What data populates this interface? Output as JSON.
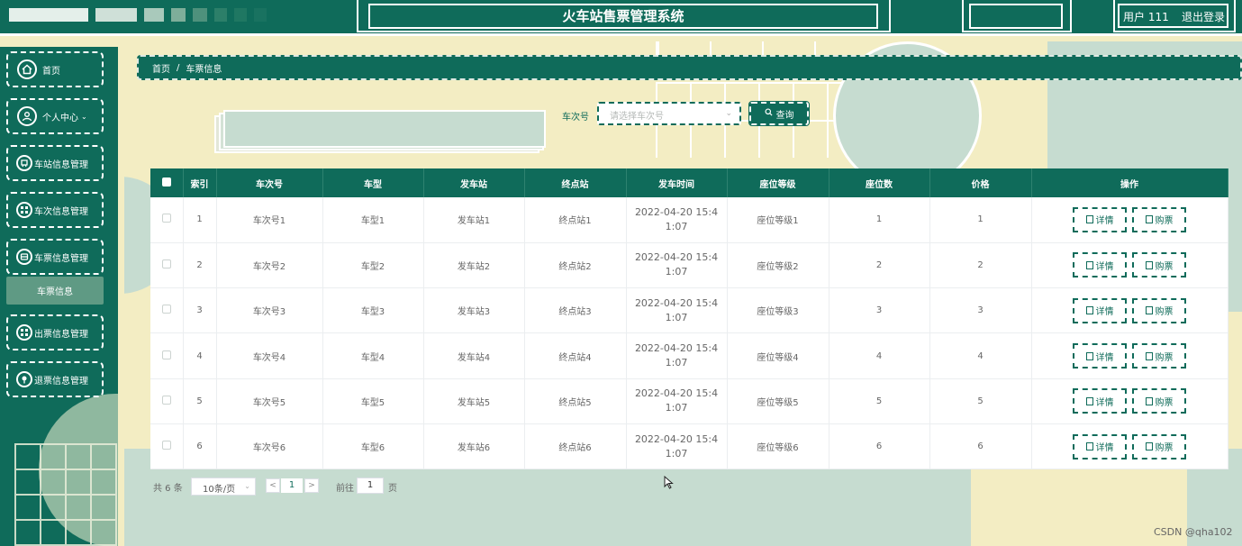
{
  "header": {
    "system_title": "火车站售票管理系统",
    "user_label": "用户 111",
    "logout_label": "退出登录",
    "accent_color": "#0f6b5a"
  },
  "sidebar": {
    "items": [
      {
        "label": "首页",
        "icon": "home-icon"
      },
      {
        "label": "个人中心",
        "icon": "user-icon",
        "has_chevron": true
      },
      {
        "label": "车站信息管理",
        "icon": "station-icon"
      },
      {
        "label": "车次信息管理",
        "icon": "grid-icon"
      },
      {
        "label": "车票信息管理",
        "icon": "ticket-icon"
      },
      {
        "label": "出票信息管理",
        "icon": "grid-icon"
      },
      {
        "label": "退票信息管理",
        "icon": "pin-icon"
      }
    ],
    "active_submenu": "车票信息"
  },
  "breadcrumb": {
    "home": "首页",
    "separator": "/",
    "current": "车票信息"
  },
  "search": {
    "label": "车次号",
    "placeholder": "请选择车次号",
    "button_label": "查询"
  },
  "table": {
    "columns": [
      "索引",
      "车次号",
      "车型",
      "发车站",
      "终点站",
      "发车时间",
      "座位等级",
      "座位数",
      "价格",
      "操作"
    ],
    "rows": [
      {
        "index": "1",
        "train_no": "车次号1",
        "type": "车型1",
        "from": "发车站1",
        "to": "终点站1",
        "time": "2022-04-20 15:41:07",
        "seat_class": "座位等级1",
        "seats": "1",
        "price": "1"
      },
      {
        "index": "2",
        "train_no": "车次号2",
        "type": "车型2",
        "from": "发车站2",
        "to": "终点站2",
        "time": "2022-04-20 15:41:07",
        "seat_class": "座位等级2",
        "seats": "2",
        "price": "2"
      },
      {
        "index": "3",
        "train_no": "车次号3",
        "type": "车型3",
        "from": "发车站3",
        "to": "终点站3",
        "time": "2022-04-20 15:41:07",
        "seat_class": "座位等级3",
        "seats": "3",
        "price": "3"
      },
      {
        "index": "4",
        "train_no": "车次号4",
        "type": "车型4",
        "from": "发车站4",
        "to": "终点站4",
        "time": "2022-04-20 15:41:07",
        "seat_class": "座位等级4",
        "seats": "4",
        "price": "4"
      },
      {
        "index": "5",
        "train_no": "车次号5",
        "type": "车型5",
        "from": "发车站5",
        "to": "终点站5",
        "time": "2022-04-20 15:41:07",
        "seat_class": "座位等级5",
        "seats": "5",
        "price": "5"
      },
      {
        "index": "6",
        "train_no": "车次号6",
        "type": "车型6",
        "from": "发车站6",
        "to": "终点站6",
        "time": "2022-04-20 15:41:07",
        "seat_class": "座位等级6",
        "seats": "6",
        "price": "6"
      }
    ],
    "actions": {
      "detail": "详情",
      "buy": "购票"
    }
  },
  "pagination": {
    "total": "共 6 条",
    "page_size": "10条/页",
    "prev": "<",
    "current_page": "1",
    "next": ">",
    "goto_label": "前往",
    "goto_value": "1",
    "page_suffix": "页"
  },
  "watermark": "CSDN @qha102"
}
